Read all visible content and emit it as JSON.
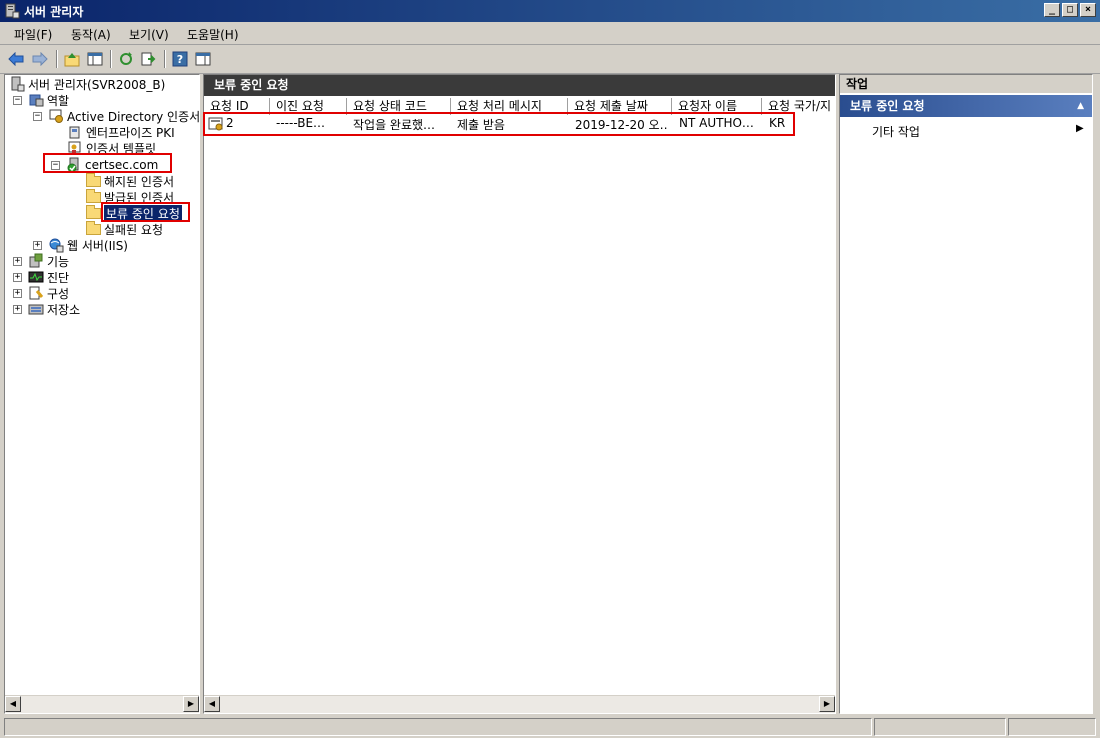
{
  "window": {
    "title": "서버 관리자",
    "controls": {
      "minimize": "_",
      "maximize": "□",
      "close": "×"
    }
  },
  "menu": [
    "파일(F)",
    "동작(A)",
    "보기(V)",
    "도움말(H)"
  ],
  "toolbar_icons": [
    "back-arrow-icon",
    "forward-arrow-icon",
    "up-folder-icon",
    "show-hide-tree-icon",
    "refresh-icon",
    "export-list-icon",
    "help-icon",
    "show-action-pane-icon"
  ],
  "tree": {
    "root": "서버 관리자(SVR2008_B)",
    "roles": "역할",
    "adcs": "Active Directory 인증서",
    "enterprise_pki": "엔터프라이즈 PKI",
    "cert_templates": "인증서 템플릿",
    "ca": "certsec.com",
    "revoked": "해지된 인증서",
    "issued": "발급된 인증서",
    "pending": "보류 중인 요청",
    "failed": "실패된 요청",
    "iis": "웹 서버(IIS)",
    "features": "기능",
    "diagnostics": "진단",
    "configuration": "구성",
    "storage": "저장소"
  },
  "center": {
    "title": "보류 중인 요청",
    "columns": [
      "요청 ID",
      "이진 요청",
      "요청 상태 코드",
      "요청 처리 메시지",
      "요청 제출 날짜",
      "요청자 이름",
      "요청 국가/지"
    ],
    "rows": [
      [
        "2",
        "-----BE…",
        "작업을 완료했…",
        "제출 받음",
        "2019-12-20 오…",
        "NT AUTHO…",
        "KR"
      ]
    ]
  },
  "actions": {
    "header": "작업",
    "group": "보류 중인 요청",
    "item": "기타 작업"
  },
  "highlight_color": "#e00000"
}
